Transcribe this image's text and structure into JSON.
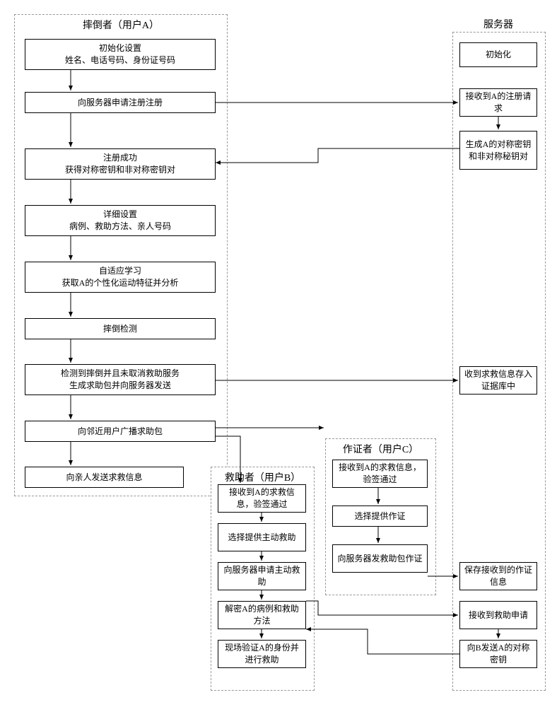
{
  "lanes": {
    "userA": {
      "title": "摔倒者（用户A）"
    },
    "server": {
      "title": "服务器"
    },
    "userB": {
      "title": "救助者（用户B）"
    },
    "userC": {
      "title": "作证者（用户C）"
    }
  },
  "boxes": {
    "a1_line1": "初始化设置",
    "a1_line2": "姓名、电话号码、身份证号码",
    "a2": "向服务器申请注册注册",
    "a3_line1": "注册成功",
    "a3_line2": "获得对称密钥和非对称密钥对",
    "a4_line1": "详细设置",
    "a4_line2": "病例、救助方法、亲人号码",
    "a5_line1": "自适应学习",
    "a5_line2": "获取A的个性化运动特征并分析",
    "a6": "摔倒检测",
    "a7_line1": "检测到摔倒并且未取消救助服务",
    "a7_line2": "生成求助包并向服务器发送",
    "a8": "向邻近用户广播求助包",
    "a9": "向亲人发送求救信息",
    "s1": "初始化",
    "s2": "接收到A的注册请求",
    "s3": "生成A的对称密钥和非对称秘钥对",
    "s4": "收到求救信息存入证据库中",
    "s5": "保存接收到的作证信息",
    "s6": "接收到救助申请",
    "s7": "向B发送A的对称密钥",
    "b1": "接收到A的求救信息，验签通过",
    "b2": "选择提供主动救助",
    "b3": "向服务器申请主动救助",
    "b4": "解密A的病例和救助方法",
    "b5": "现场验证A的身份并进行救助",
    "c1": "接收到A的求救信息，验签通过",
    "c2": "选择提供作证",
    "c3": "向服务器发救助包作证"
  }
}
